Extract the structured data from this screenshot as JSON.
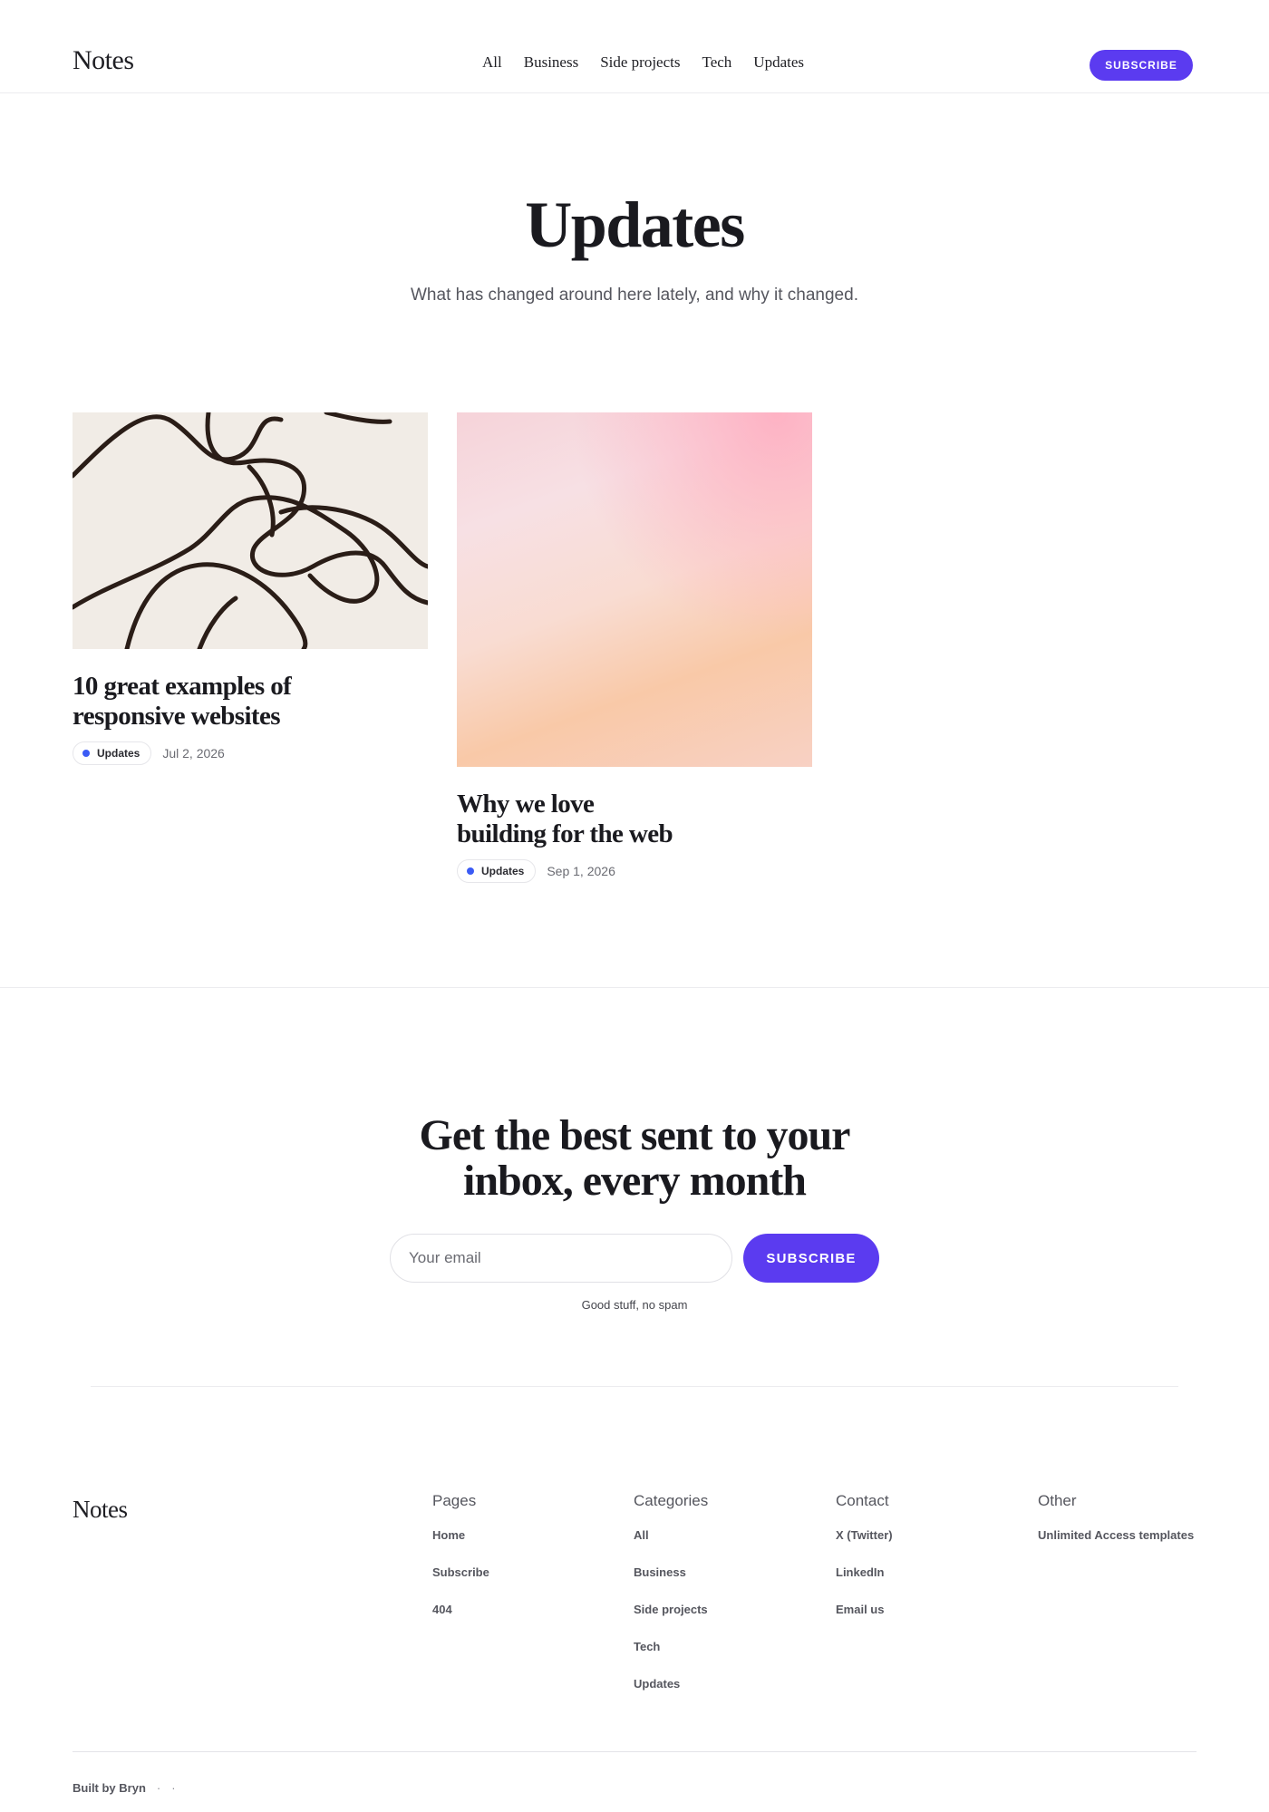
{
  "header": {
    "brand": "Notes",
    "nav": [
      "All",
      "Business",
      "Side projects",
      "Tech",
      "Updates"
    ],
    "subscribe_label": "SUBSCRIBE"
  },
  "hero": {
    "title": "Updates",
    "subtitle": "What has changed around here lately, and why it changed."
  },
  "posts": [
    {
      "title_line1": "10 great examples of",
      "title_line2": "responsive websites",
      "tag": "Updates",
      "date": "Jul 2, 2026"
    },
    {
      "title_line1": "Why we love",
      "title_line2": "building for the web",
      "tag": "Updates",
      "date": "Sep 1, 2026"
    }
  ],
  "newsletter": {
    "title_line1": "Get the best sent to your",
    "title_line2": "inbox, every month",
    "email_placeholder": "Your email",
    "button_label": "SUBSCRIBE",
    "note": "Good stuff, no spam"
  },
  "footer": {
    "brand": "Notes",
    "columns": {
      "pages": {
        "heading": "Pages",
        "links": [
          "Home",
          "Subscribe",
          "404"
        ]
      },
      "categories": {
        "heading": "Categories",
        "links": [
          "All",
          "Business",
          "Side projects",
          "Tech",
          "Updates"
        ]
      },
      "contact": {
        "heading": "Contact",
        "links": [
          "X (Twitter)",
          "LinkedIn",
          "Email us"
        ]
      },
      "other": {
        "heading": "Other",
        "links": [
          "Unlimited Access templates"
        ]
      }
    },
    "built_by": "Built by Bryn",
    "separator": "·"
  },
  "colors": {
    "accent": "#5b3bf0",
    "tag_dot": "#3b5bf5"
  },
  "icons": {
    "tag_indicator": "dot-icon"
  }
}
